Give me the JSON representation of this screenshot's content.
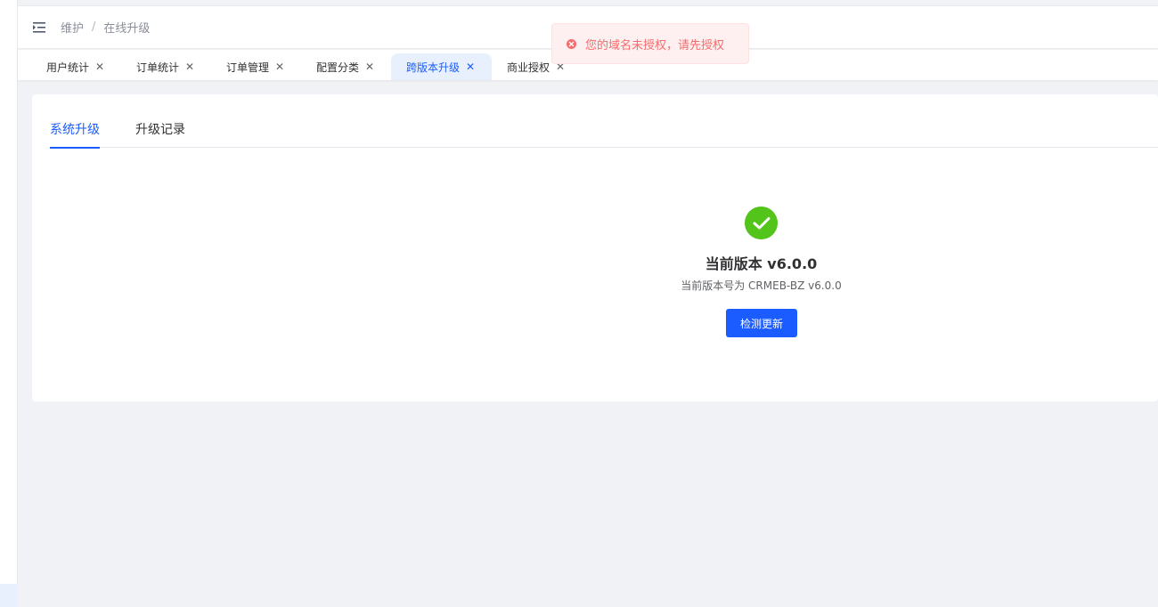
{
  "header": {
    "breadcrumb": [
      "维护",
      "在线升级"
    ]
  },
  "tags": [
    {
      "label": "用户统计",
      "active": false
    },
    {
      "label": "订单统计",
      "active": false
    },
    {
      "label": "订单管理",
      "active": false
    },
    {
      "label": "配置分类",
      "active": false
    },
    {
      "label": "跨版本升级",
      "active": true
    },
    {
      "label": "商业授权",
      "active": false
    }
  ],
  "toast": {
    "type": "error",
    "message": "您的域名未授权，请先授权"
  },
  "tabs": [
    {
      "label": "系统升级",
      "active": true
    },
    {
      "label": "升级记录",
      "active": false
    }
  ],
  "result": {
    "title": "当前版本 v6.0.0",
    "subtitle": "当前版本号为 CRMEB-BZ v6.0.0",
    "button_label": "检测更新"
  },
  "colors": {
    "primary": "#1a5cff",
    "success": "#52c41a",
    "error": "#f56c6c",
    "error_bg": "#fef0f0"
  },
  "icons": {
    "menu": "menu-fold-icon",
    "tag_close": "close-icon",
    "toast": "error-circle-icon",
    "result": "check-circle-icon"
  }
}
